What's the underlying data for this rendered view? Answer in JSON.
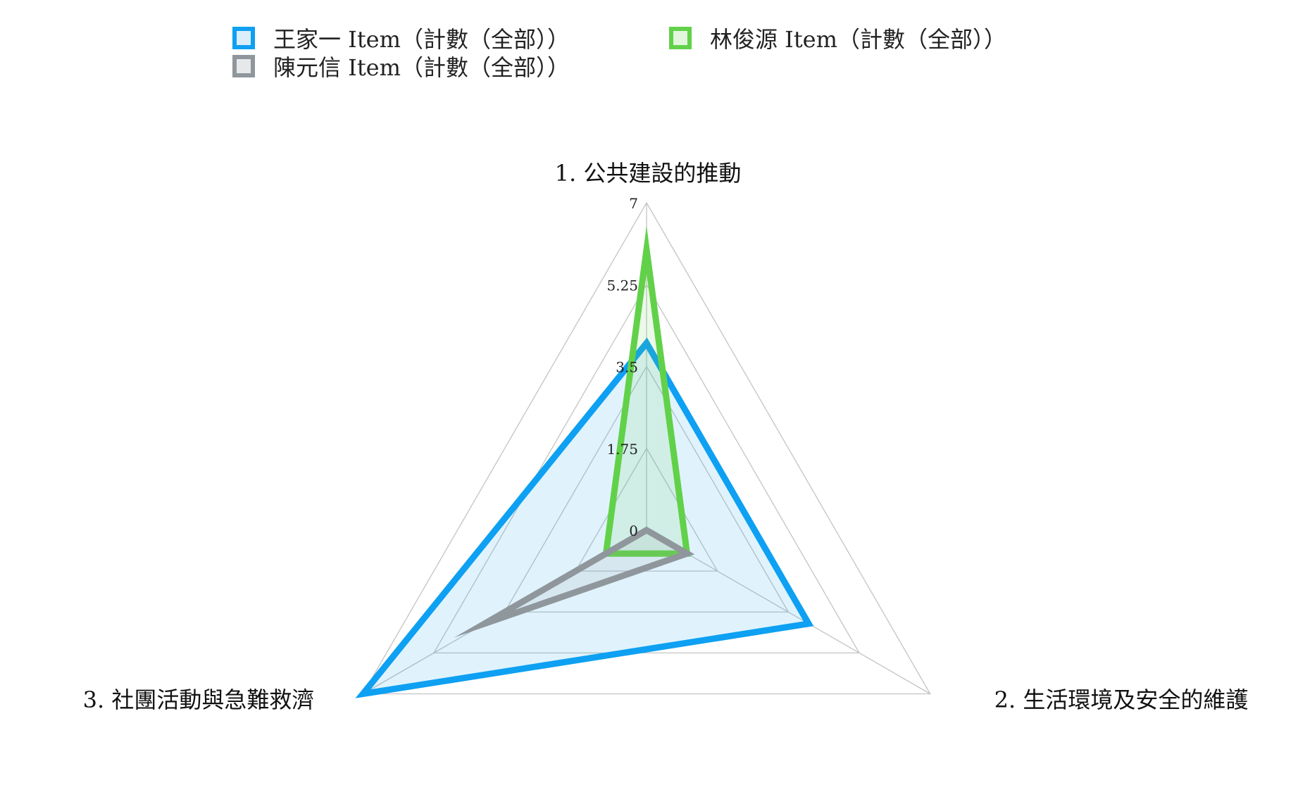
{
  "chart_data": {
    "type": "radar",
    "title": "",
    "categories": [
      "1. 公共建設的推動",
      "2. 生活環境及安全的維護",
      "3. 社團活動與急難救濟"
    ],
    "axis": {
      "min": 0,
      "max": 7,
      "ticks": [
        0,
        1.75,
        3.5,
        5.25,
        7
      ],
      "tick_labels": [
        "0",
        "1.75",
        "3.5",
        "5.25",
        "7"
      ]
    },
    "grid": true,
    "legend_position": "top",
    "series": [
      {
        "name": "王家一 Item（計數（全部））",
        "values": [
          4,
          4,
          7
        ],
        "color": "#0ea0f2",
        "fill": "#dceefa"
      },
      {
        "name": "林俊源 Item（計數（全部））",
        "values": [
          6,
          1,
          1
        ],
        "color": "#62d14a",
        "fill": "#e2f6dc"
      },
      {
        "name": "陳元信 Item（計數（全部））",
        "values": [
          0,
          1,
          4
        ],
        "color": "#8f979c",
        "fill": "#e6e8ea"
      }
    ]
  }
}
